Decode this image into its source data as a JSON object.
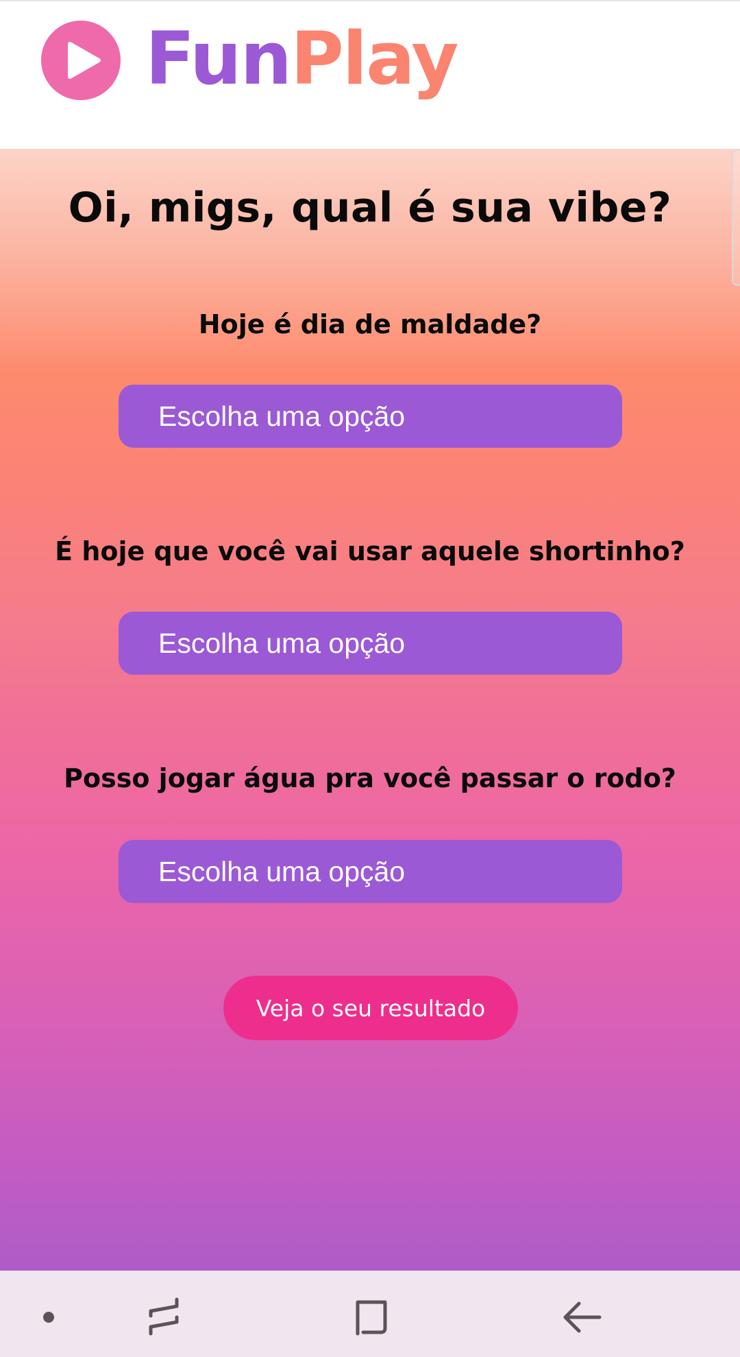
{
  "header": {
    "logo_part1": "Fun",
    "logo_part2": "Play",
    "logo_icon": "play-icon",
    "colors": {
      "purple": "#9b59d6",
      "coral": "#fb8470",
      "pink": "#ee6aaa"
    }
  },
  "main": {
    "title": "Oi, migs, qual é sua vibe?",
    "questions": [
      {
        "label": "Hoje é dia de maldade?",
        "select_value": "Escolha uma opção"
      },
      {
        "label": "É hoje que você vai usar aquele shortinho?",
        "select_value": "Escolha uma opção"
      },
      {
        "label": "Posso jogar água pra você passar o rodo?",
        "select_value": "Escolha uma opção"
      }
    ],
    "submit_label": "Veja o seu resultado",
    "colors": {
      "select_bg": "#9b59d6",
      "button_bg": "#ee2e8c"
    }
  },
  "navbar": {
    "icons": [
      "dot-icon",
      "recent-apps-icon",
      "home-icon",
      "back-icon"
    ]
  }
}
